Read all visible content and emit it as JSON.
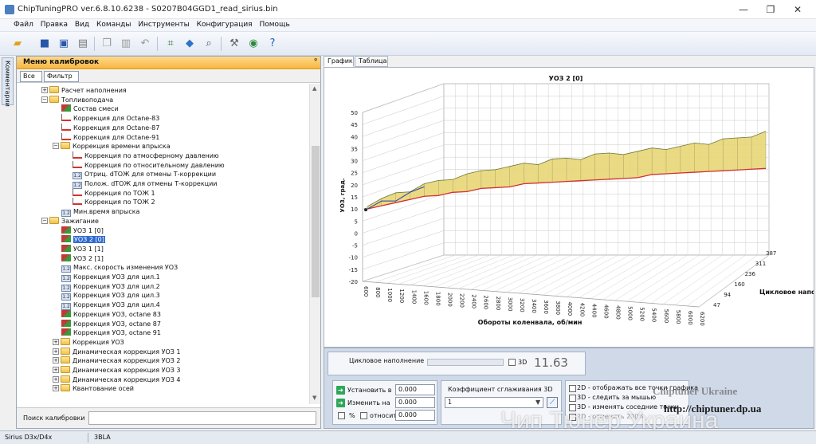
{
  "window": {
    "title": "ChipTuningPRO ver.6.8.10.6238 - S0207B04GGD1_read_sirius.bin",
    "controls": [
      "—",
      "❐",
      "✕"
    ]
  },
  "menu": [
    "Файл",
    "Правка",
    "Вид",
    "Команды",
    "Инструменты",
    "Конфигурация",
    "Помощь"
  ],
  "side_tab": "Комментарии",
  "left_panel": {
    "title": "Меню калибровок",
    "pin": "ᵠ",
    "filter_tabs": [
      "Все",
      "Фильтр"
    ],
    "search_label": "Поиск калибровки",
    "search_value": ""
  },
  "tree": [
    {
      "level": 1,
      "type": "folder",
      "exp": "+",
      "label": "Расчет наполнения"
    },
    {
      "level": 1,
      "type": "folder",
      "exp": "−",
      "label": "Топливоподача"
    },
    {
      "level": 2,
      "type": "g3d",
      "label": "Состав смеси"
    },
    {
      "level": 2,
      "type": "g2d",
      "label": "Коррекция для Octane-83"
    },
    {
      "level": 2,
      "type": "g2d",
      "label": "Коррекция для Octane-87"
    },
    {
      "level": 2,
      "type": "g2d",
      "label": "Коррекция для Octane-91"
    },
    {
      "level": 2,
      "type": "folder",
      "exp": "−",
      "label": "Коррекция времени впрыска"
    },
    {
      "level": 3,
      "type": "g2d",
      "label": "Коррекция по атмосферному давлению"
    },
    {
      "level": 3,
      "type": "g2d",
      "label": "Коррекция по относительному давлению"
    },
    {
      "level": 3,
      "type": "v12",
      "label": "Отриц. dТОЖ для отмены Т-коррекции"
    },
    {
      "level": 3,
      "type": "v12",
      "label": "Полож. dТОЖ для отмены Т-коррекции"
    },
    {
      "level": 3,
      "type": "g2d",
      "label": "Коррекция по ТОЖ 1"
    },
    {
      "level": 3,
      "type": "g2d",
      "label": "Коррекция по ТОЖ 2"
    },
    {
      "level": 2,
      "type": "v12",
      "label": "Мин.время впрыска"
    },
    {
      "level": 1,
      "type": "folder",
      "exp": "−",
      "label": "Зажигание"
    },
    {
      "level": 2,
      "type": "g3d",
      "label": "УОЗ 1 [0]"
    },
    {
      "level": 2,
      "type": "g3d",
      "label": "УОЗ 2 [0]",
      "selected": true
    },
    {
      "level": 2,
      "type": "g3d",
      "label": "УОЗ 1 [1]"
    },
    {
      "level": 2,
      "type": "g3d",
      "label": "УОЗ 2 [1]"
    },
    {
      "level": 2,
      "type": "v12",
      "label": "Макс. скорость изменения УОЗ"
    },
    {
      "level": 2,
      "type": "v12",
      "label": "Коррекция УОЗ для цил.1"
    },
    {
      "level": 2,
      "type": "v12",
      "label": "Коррекция УОЗ для цил.2"
    },
    {
      "level": 2,
      "type": "v12",
      "label": "Коррекция УОЗ для цил.3"
    },
    {
      "level": 2,
      "type": "v12",
      "label": "Коррекция УОЗ для цил.4"
    },
    {
      "level": 2,
      "type": "g3d",
      "label": "Коррекция УОЗ, octane 83"
    },
    {
      "level": 2,
      "type": "g3d",
      "label": "Коррекция УОЗ, octane 87"
    },
    {
      "level": 2,
      "type": "g3d",
      "label": "Коррекция УОЗ, octane 91"
    },
    {
      "level": 2,
      "type": "folder",
      "exp": "+",
      "label": "Коррекция УОЗ"
    },
    {
      "level": 2,
      "type": "folder",
      "exp": "+",
      "label": "Динамическая коррекция УОЗ 1"
    },
    {
      "level": 2,
      "type": "folder",
      "exp": "+",
      "label": "Динамическая коррекция УОЗ 2"
    },
    {
      "level": 2,
      "type": "folder",
      "exp": "+",
      "label": "Динамическая коррекция УОЗ 3"
    },
    {
      "level": 2,
      "type": "folder",
      "exp": "+",
      "label": "Динамическая коррекция УОЗ 4"
    },
    {
      "level": 2,
      "type": "folder",
      "exp": "+",
      "label": "Квантование осей"
    }
  ],
  "right_tabs": [
    "График",
    "Таблица"
  ],
  "chart_data": {
    "type": "surface",
    "title": "УОЗ 2 [0]",
    "xlabel": "Обороты коленвала, об/мин",
    "ylabel": "УОЗ, град.",
    "zlabel": "Цикловое напо",
    "x_ticks": [
      600,
      800,
      1000,
      1200,
      1400,
      1600,
      1800,
      2000,
      2200,
      2400,
      2600,
      2800,
      3000,
      3200,
      3400,
      3600,
      3800,
      4000,
      4200,
      4400,
      4600,
      4800,
      5000,
      5200,
      5400,
      5600,
      5800,
      6000,
      6200
    ],
    "y_ticks": [
      -20,
      -15,
      -10,
      -5,
      0,
      5,
      10,
      15,
      20,
      25,
      30,
      35,
      40,
      45,
      50
    ],
    "ylim": [
      -20,
      50
    ],
    "z_ticks": [
      47,
      94,
      160,
      236,
      311,
      387
    ],
    "series": [
      {
        "name": "",
        "values": [
          10,
          12,
          14,
          15,
          17,
          18,
          19,
          20,
          21,
          22,
          22,
          23,
          23,
          24,
          24,
          24,
          25,
          25,
          25,
          25,
          26,
          26,
          26,
          27,
          27,
          28,
          28,
          29,
          30
        ]
      },
      {
        "name": "",
        "values": [
          10,
          11,
          12,
          13,
          14,
          14,
          15,
          15,
          16,
          16,
          16,
          17,
          17,
          17,
          17,
          17,
          17,
          17,
          17,
          17,
          18,
          18,
          18,
          18,
          18,
          18,
          18,
          18,
          18
        ]
      }
    ]
  },
  "bottom": {
    "load_label": "Цикловое наполнение",
    "load_3d": "3D",
    "load_value": "11.63",
    "set_label": "Установить в",
    "set_value": "0.000",
    "change_label": "Изменить на",
    "change_value": "0.000",
    "pct_label": "%",
    "rel_label": "относит.",
    "rel_value": "0.000",
    "smooth_label": "Коэффициент сглаживания 3D",
    "smooth_value": "1",
    "hints": [
      "2D - отображать все точки графика",
      "3D - следить за мышью",
      "3D - изменять соседние точки",
      "2D - отменить 200%"
    ]
  },
  "watermarks": {
    "brand": "Chiptuner Ukraine",
    "url": "http://chiptuner.dp.ua",
    "big": "Чип Тюнер Украина"
  },
  "status": [
    "Sirius D3x/D4x",
    "3BLA"
  ]
}
